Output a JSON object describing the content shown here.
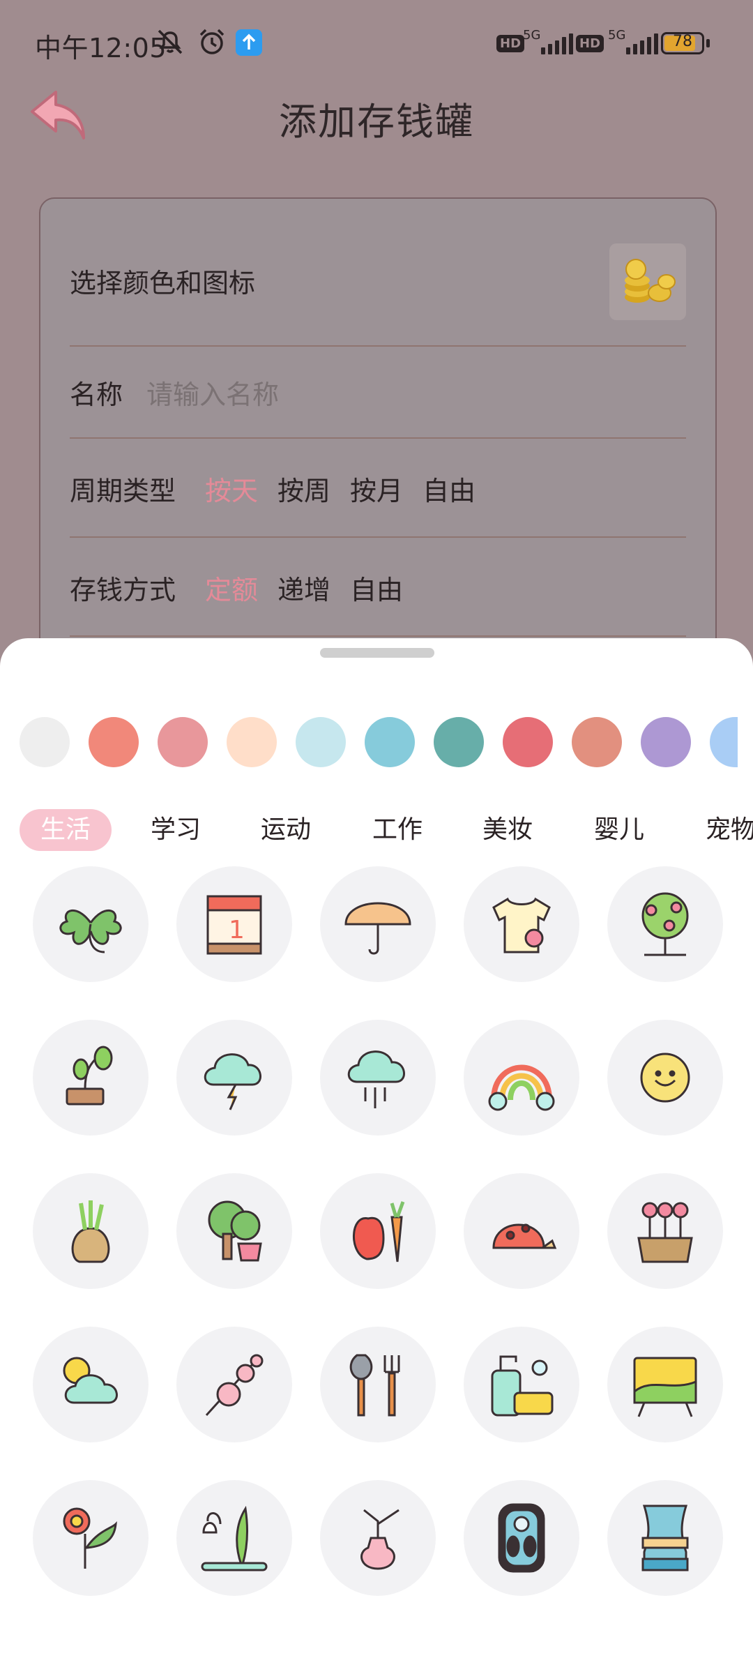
{
  "status": {
    "time": "中午12:05",
    "battery": "78",
    "hd1": "HD",
    "hd2": "HD",
    "net1": "5G",
    "net2": "5G"
  },
  "header": {
    "title": "添加存钱罐"
  },
  "form": {
    "color_icon_label": "选择颜色和图标",
    "name_label": "名称",
    "name_placeholder": "请输入名称",
    "cycle_label": "周期类型",
    "cycle_options": [
      "按天",
      "按周",
      "按月",
      "自由"
    ],
    "cycle_selected": "按天",
    "method_label": "存钱方式",
    "method_options": [
      "定额",
      "递增",
      "自由"
    ],
    "method_selected": "定额"
  },
  "colors": [
    "#eeeeee",
    "#f1887a",
    "#e8979b",
    "#ffdec9",
    "#c6e7ee",
    "#86cbdb",
    "#67aea9",
    "#e66e76",
    "#e2907f",
    "#ad98d3",
    "#a9cdf5"
  ],
  "tabs": [
    "生活",
    "学习",
    "运动",
    "工作",
    "美妆",
    "婴儿",
    "宠物"
  ],
  "active_tab": "生活",
  "icons": [
    "clover-icon",
    "calendar-icon",
    "umbrella-icon",
    "tshirt-icon",
    "flower-tree-icon",
    "sprout-icon",
    "thunder-cloud-icon",
    "rain-cloud-icon",
    "rainbow-icon",
    "sun-icon",
    "onion-icon",
    "tree-pot-icon",
    "apple-carrot-icon",
    "snail-icon",
    "flower-box-icon",
    "sun-cloud-icon",
    "blossom-branch-icon",
    "garden-tools-icon",
    "soap-icon",
    "painting-icon",
    "red-flower-icon",
    "bellflower-icon",
    "vase-branch-icon",
    "scale-icon",
    "waist-measure-icon"
  ]
}
